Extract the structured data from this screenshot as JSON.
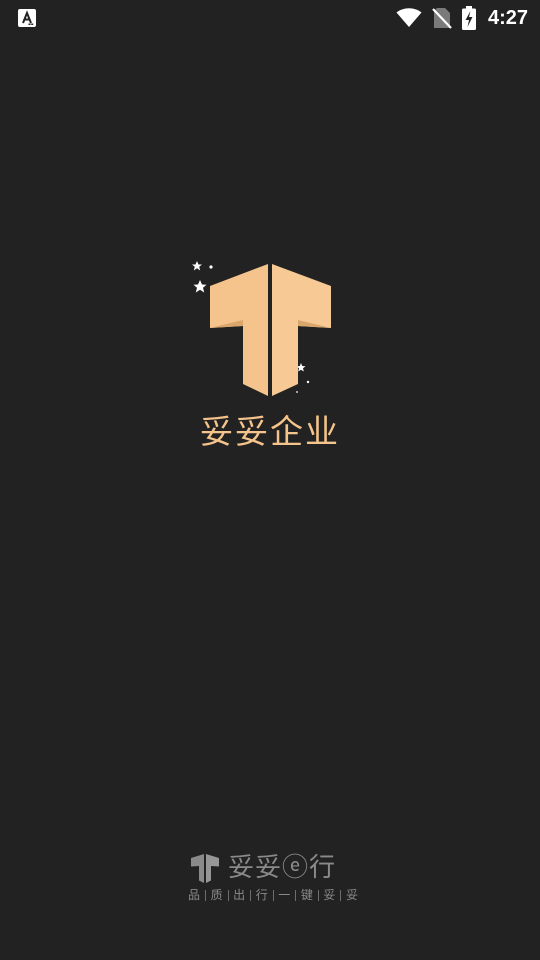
{
  "status_bar": {
    "time": "4:27",
    "notification_icon": "a-letter-icon",
    "icons": [
      "wifi-icon",
      "no-sim-icon",
      "battery-charging-icon"
    ]
  },
  "splash": {
    "app_name": "妥妥企业",
    "logo_icon": "t-logo-icon"
  },
  "footer": {
    "brand_title": "妥妥ⓔ行",
    "slogan_chars": [
      "品",
      "质",
      "出",
      "行",
      "一",
      "键",
      "妥",
      "妥"
    ]
  },
  "colors": {
    "background": "#222222",
    "brand_gold": "#f5c48c",
    "brand_gold_dark": "#e9b57a",
    "footer_gray": "#8a8a8a"
  }
}
